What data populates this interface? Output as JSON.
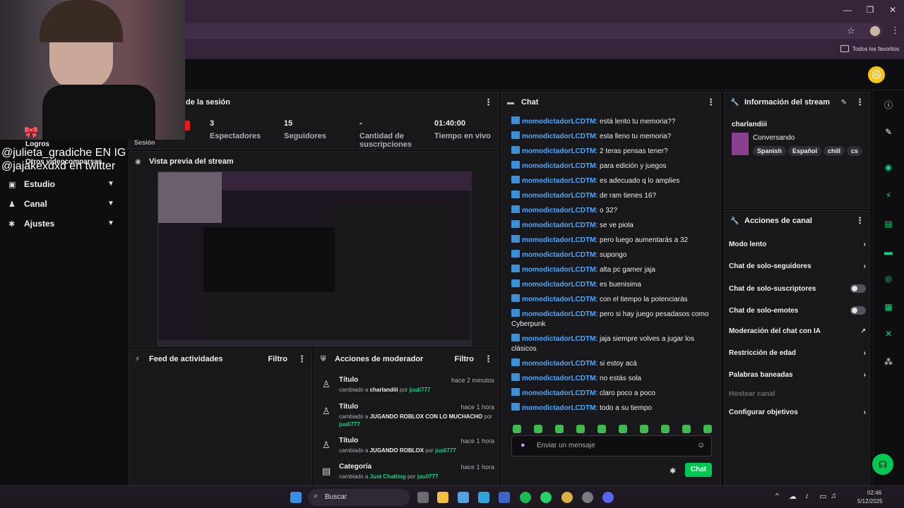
{
  "browser": {
    "bookmarks_label": "Todos los favoritos",
    "window_controls": [
      "—",
      "❐",
      "✕"
    ]
  },
  "webcam": {
    "label_line1": "@julieta_gradiche EN IG",
    "label_line2": "@jajakexdxd en twitter",
    "overlay_label": "Logros",
    "overlay_label2": "Otros videocomparsas",
    "session_word": "Sesión"
  },
  "sidebar": {
    "items": [
      {
        "label": "Estudio",
        "icon": "video-icon"
      },
      {
        "label": "Canal",
        "icon": "user-icon"
      },
      {
        "label": "Ajustes",
        "icon": "gear-icon"
      }
    ]
  },
  "session": {
    "title": "de la sesión",
    "stats": [
      {
        "value": "3",
        "label": "Espectadores"
      },
      {
        "value": "15",
        "label": "Seguidores"
      },
      {
        "value": "-",
        "label": "Cantidad de suscripciones"
      },
      {
        "value": "01:40:00",
        "label": "Tiempo en vivo"
      }
    ]
  },
  "preview": {
    "title": "Vista previa del stream"
  },
  "activity_feed": {
    "title": "Feed de actividades",
    "filter": "Filtro"
  },
  "mod_actions": {
    "title": "Acciones de moderador",
    "filter": "Filtro",
    "items": [
      {
        "title": "Título",
        "time": "hace 2 minutos",
        "prefix": "cambiado a",
        "value": "charlandiii",
        "by_word": "por",
        "by": "juuli777",
        "icon": "user-edit-icon"
      },
      {
        "title": "Título",
        "time": "hace 1 hora",
        "prefix": "cambiado a",
        "value": "JUGANDO ROBLOX CON LO MUCHACHO",
        "by_word": "por",
        "by": "juuli777",
        "icon": "user-edit-icon"
      },
      {
        "title": "Título",
        "time": "hace 1 hora",
        "prefix": "cambiado a",
        "value": "JUGANDO ROBLOX",
        "by_word": "por",
        "by": "juuli777",
        "icon": "user-edit-icon"
      },
      {
        "title": "Categoría",
        "time": "hace 1 hora",
        "prefix": "cambiado a",
        "value": "Just Chatting",
        "by_word": "por",
        "by": "juuli777",
        "icon": "category-icon"
      }
    ]
  },
  "chat": {
    "title": "Chat",
    "user": "momodictadorLCDTM",
    "messages": [
      ": está lento tu memoria??",
      ": esta lleno tu memoria?",
      ": 2 teras pensas tener?",
      ": para edición y juegos",
      ": es adecuado q lo amplies",
      ": de ram tienes 16?",
      ": o 32?",
      ": se ve piola",
      ": pero luego aumentarás a 32",
      ": supongo",
      ": alta pc gamer jaja",
      ": es buenisima",
      ": con el tiempo la potenciarás",
      ": pero si hay juego pesadasos como Cyberpunk",
      ": jaja siempre volves a jugar los clásicos",
      ": si estoy acá",
      ": no estás sola",
      ": claro poco a poco",
      ": todo a su tiempo"
    ],
    "input_placeholder": "Enviar un mensaje",
    "send_label": "Chat"
  },
  "stream_info": {
    "title": "Información del stream",
    "stream_title": "charlandiii",
    "category": "Conversando",
    "tags": [
      "Spanish",
      "Español",
      "chill",
      "cs"
    ]
  },
  "channel_actions": {
    "title": "Acciones de canal",
    "items": [
      {
        "label": "Modo lento",
        "control": "chevron"
      },
      {
        "label": "Chat de solo-seguidores",
        "control": "chevron"
      },
      {
        "label": "Chat de solo-suscriptores",
        "control": "toggle"
      },
      {
        "label": "Chat de solo-emotes",
        "control": "toggle"
      },
      {
        "label": "Moderación del chat con IA",
        "control": "external"
      },
      {
        "label": "Restricción de edad",
        "control": "chevron"
      },
      {
        "label": "Palabras baneadas",
        "control": "chevron"
      },
      {
        "label": "Hostear canal",
        "control": "none"
      },
      {
        "label": "Configurar objetivos",
        "control": "chevron"
      }
    ]
  },
  "taskbar": {
    "search_label": "Buscar",
    "time": "02:46",
    "date": "5/12/2025"
  },
  "colors": {
    "accent_green": "#00db84",
    "chat_user_blue": "#4aa8ff",
    "chrome_purple": "#35243a"
  }
}
